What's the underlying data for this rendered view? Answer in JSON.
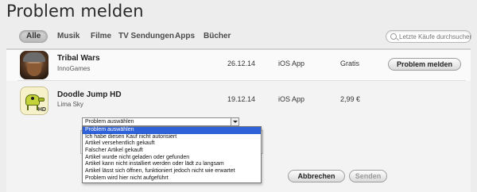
{
  "window": {
    "title": "Problem melden"
  },
  "tabs": [
    {
      "label": "Alle",
      "active": true
    },
    {
      "label": "Musik"
    },
    {
      "label": "Filme"
    },
    {
      "label": "TV Sendungen"
    },
    {
      "label": "Apps"
    },
    {
      "label": "Bücher"
    }
  ],
  "search": {
    "placeholder": "Letzte Käufe durchsuchen",
    "icon": "search-icon"
  },
  "purchases": [
    {
      "name": "Tribal Wars",
      "developer": "InnoGames",
      "date": "26.12.14",
      "type": "iOS App",
      "price": "Gratis",
      "action": "Problem melden",
      "icon": "tribal-wars-app-icon"
    },
    {
      "name": "Doodle Jump HD",
      "developer": "Lima Sky",
      "date": "19.12.14",
      "type": "iOS App",
      "price": "2,99 €",
      "icon": "doodle-jump-app-icon"
    }
  ],
  "problem_form": {
    "select_value": "Problem auswählen",
    "options": [
      "Problem auswählen",
      "Ich habe diesen Kauf nicht autorisiert",
      "Artikel versehentlich gekauft",
      "Falscher Artikel gekauft",
      "Artikel wurde nicht geladen oder gefunden",
      "Artikel kann nicht installiert werden oder lädt zu langsam",
      "Artikel lässt sich öffnen, funktioniert jedoch nicht wie erwartet",
      "Problem wird hier nicht aufgeführt"
    ],
    "selected_index": 0,
    "cancel_label": "Abbrechen",
    "send_label": "Senden"
  },
  "colors": {
    "highlight": "#2f62d8",
    "background": "#ededed"
  }
}
